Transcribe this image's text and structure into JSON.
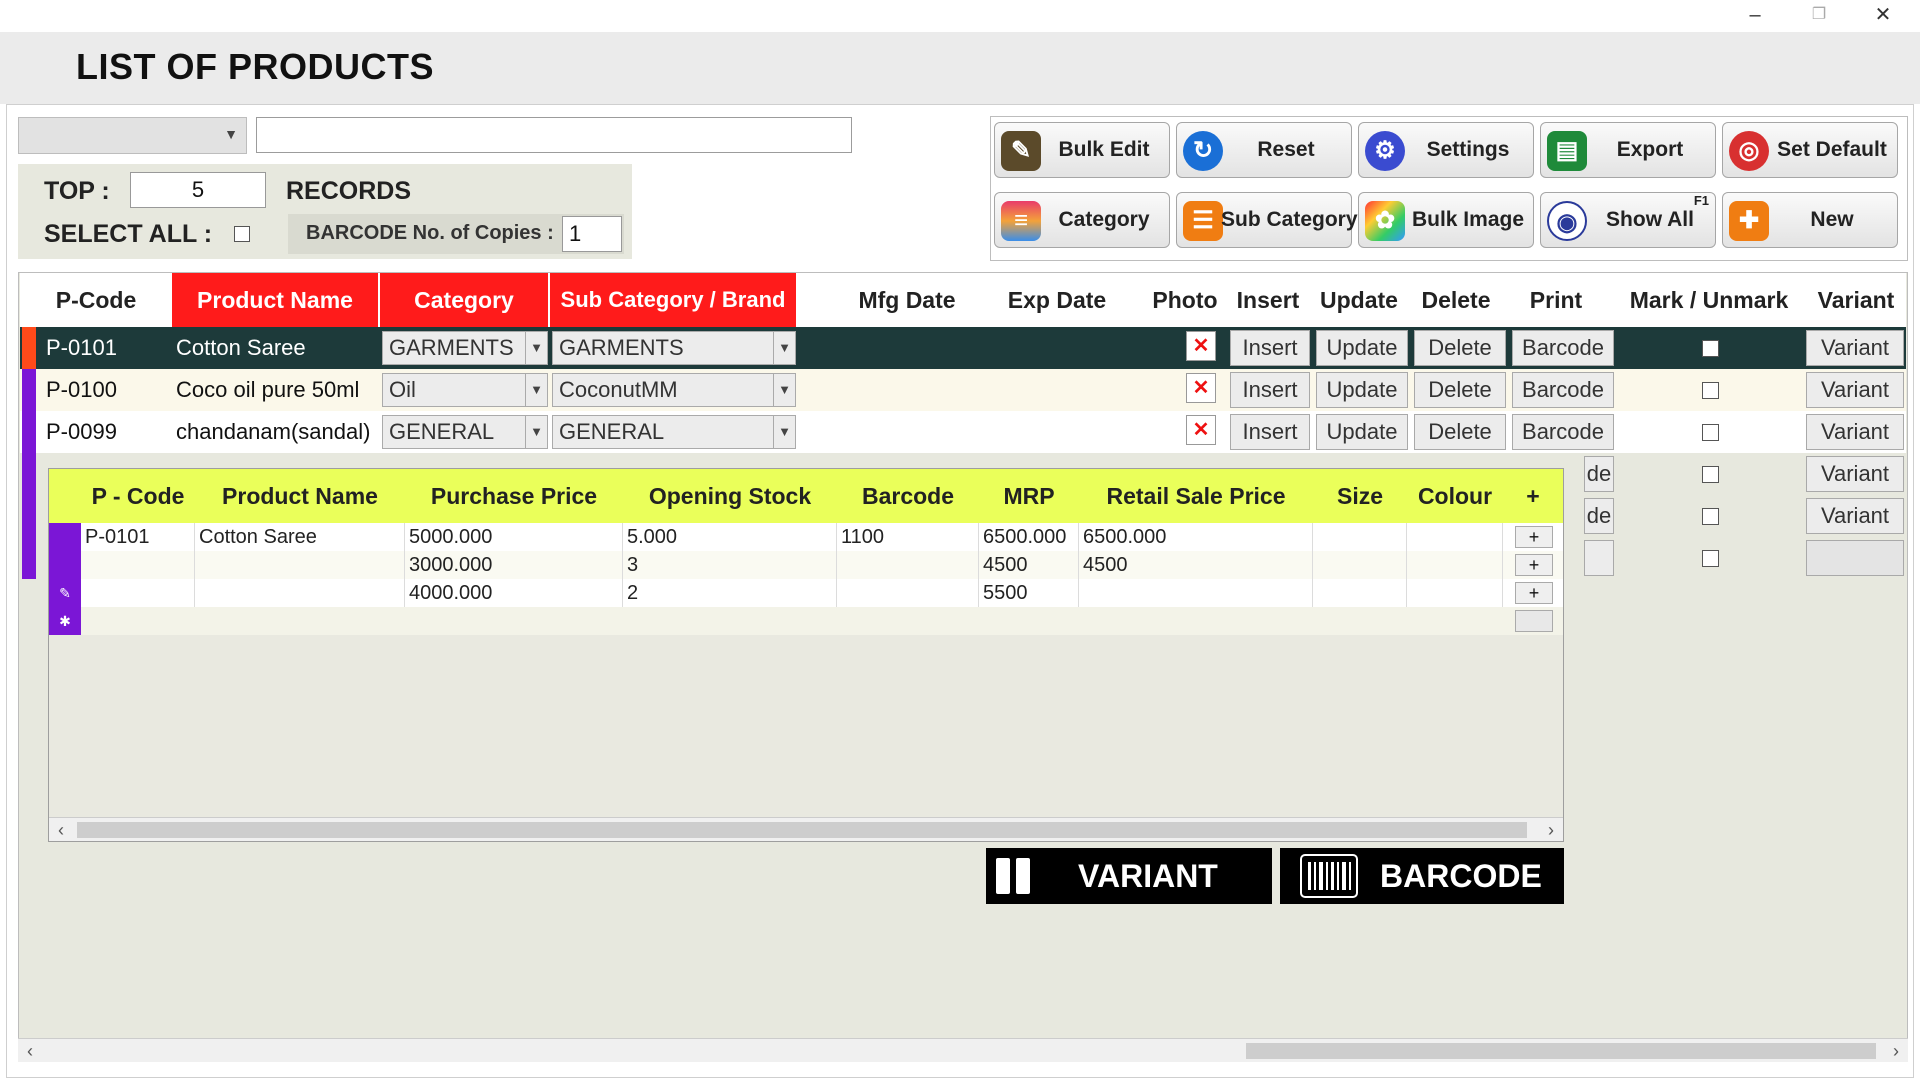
{
  "window": {
    "title": "LIST OF PRODUCTS",
    "min": "–",
    "max": "❐",
    "close": "✕"
  },
  "filter": {
    "search_value": ""
  },
  "top": {
    "label": "TOP :",
    "value": "5",
    "records": "RECORDS",
    "select_all": "SELECT ALL :",
    "barcode_copies_label": "BARCODE No. of Copies :",
    "barcode_copies_value": "1"
  },
  "toolbar": {
    "bulk_edit": "Bulk Edit",
    "reset": "Reset",
    "settings": "Settings",
    "export": "Export",
    "set_default": "Set Default",
    "category": "Category",
    "sub_category": "Sub Category",
    "bulk_image": "Bulk Image",
    "show_all": "Show All",
    "show_all_key": "F1",
    "new": "New"
  },
  "grid": {
    "headers": {
      "pcode": "P-Code",
      "product_name": "Product Name",
      "category": "Category",
      "sub_category": "Sub Category / Brand",
      "mfg_date": "Mfg Date",
      "exp_date": "Exp Date",
      "photo": "Photo",
      "insert": "Insert",
      "update": "Update",
      "delete": "Delete",
      "print": "Print",
      "mark": "Mark / Unmark",
      "variant": "Variant"
    },
    "rows": [
      {
        "pcode": "P-0101",
        "name": "Cotton Saree",
        "category": "GARMENTS",
        "sub": "GARMENTS"
      },
      {
        "pcode": "P-0100",
        "name": "Coco oil pure 50ml",
        "category": "Oil",
        "sub": "CoconutMM"
      },
      {
        "pcode": "P-0099",
        "name": "chandanam(sandal)",
        "category": "GENERAL",
        "sub": "GENERAL"
      }
    ],
    "btn": {
      "insert": "Insert",
      "update": "Update",
      "delete": "Delete",
      "barcode": "Barcode",
      "variant": "Variant",
      "partial": "de",
      "photo_x": "✕"
    }
  },
  "variant_grid": {
    "headers": {
      "pcode": "P - Code",
      "name": "Product Name",
      "purchase": "Purchase Price",
      "opening": "Opening Stock",
      "barcode": "Barcode",
      "mrp": "MRP",
      "retail": "Retail Sale Price",
      "size": "Size",
      "colour": "Colour",
      "add": "+"
    },
    "rows": [
      {
        "pcode": "P-0101",
        "name": "Cotton Saree",
        "purchase": "5000.000",
        "opening": "5.000",
        "barcode": "1100",
        "mrp": "6500.000",
        "retail": "6500.000"
      },
      {
        "pcode": "",
        "name": "",
        "purchase": "3000.000",
        "opening": "3",
        "barcode": "",
        "mrp": "4500",
        "retail": "4500"
      },
      {
        "pcode": "",
        "name": "",
        "purchase": "4000.000",
        "opening": "2",
        "barcode": "",
        "mrp": "5500",
        "retail": ""
      }
    ],
    "plus": "+"
  },
  "actions": {
    "variant": "VARIANT",
    "barcode": "BARCODE"
  },
  "scroll": {
    "left": "‹",
    "right": "›"
  },
  "colors": {
    "header_red": "#ff1b1b",
    "selected_row": "#1d3a3a",
    "variant_header": "#eaff5a",
    "row_marker": "#7b16d6",
    "accent_orange": "#ff4a1a"
  }
}
